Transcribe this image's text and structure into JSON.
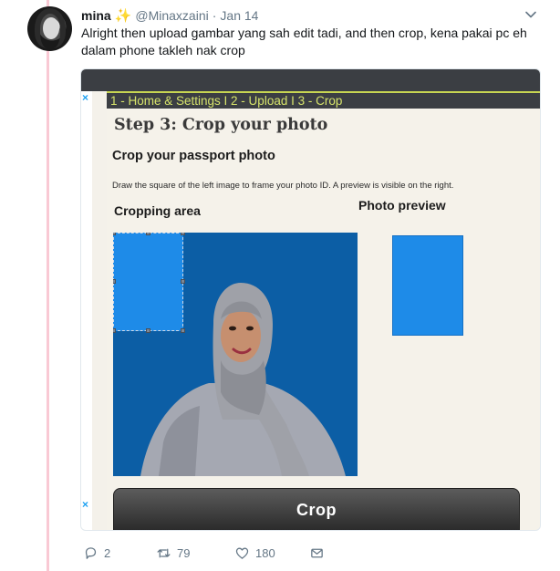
{
  "tweet": {
    "author_name": "mina",
    "author_emoji": "✨",
    "handle": "@Minaxzaini",
    "separator": "·",
    "time": "Jan 14",
    "text": "Alright then upload gambar yang sah edit tadi, and then crop, kena pakai pc eh dalam phone takleh nak crop"
  },
  "image": {
    "close_marks": [
      "×",
      "×"
    ],
    "nav": "1 - Home & Settings  I  2 - Upload  I  3 - Crop",
    "step_title": "Step 3: Crop your photo",
    "heading": "Crop your passport photo",
    "instructions": "Draw the square of the left image to frame your photo ID. A preview is visible on the right.",
    "cropping_label": "Cropping area",
    "preview_label": "Photo preview",
    "crop_button": "Crop",
    "crop_color": "#1e8be8",
    "photo_background": "#0c5ea5"
  },
  "actions": {
    "replies": "2",
    "retweets": "79",
    "likes": "180"
  },
  "icons": [
    "chevron-down-icon",
    "reply-icon",
    "retweet-icon",
    "like-icon",
    "message-icon"
  ]
}
